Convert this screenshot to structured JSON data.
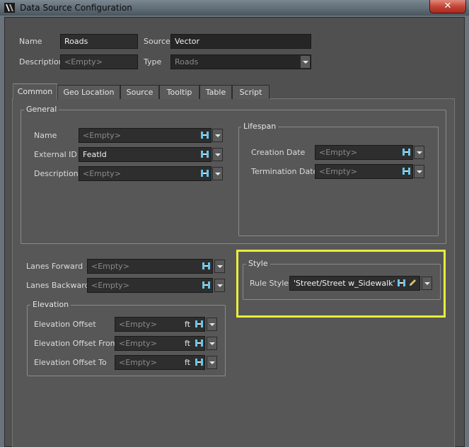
{
  "window": {
    "title": "Data Source Configuration",
    "close_glyph": "✕"
  },
  "header": {
    "name_label": "Name",
    "name_value": "Roads",
    "source_label": "Source",
    "source_value": "Vector",
    "description_label": "Description",
    "description_placeholder": "<Empty>",
    "type_label": "Type",
    "type_value": "Roads"
  },
  "tabs": [
    "Common",
    "Geo Location",
    "Source",
    "Tooltip",
    "Table",
    "Script"
  ],
  "active_tab": "Common",
  "general": {
    "title": "General",
    "name_label": "Name",
    "name_value": "<Empty>",
    "external_id_label": "External ID",
    "external_id_value": "FeatId",
    "description_label": "Description",
    "description_value": "<Empty>"
  },
  "lifespan": {
    "title": "Lifespan",
    "creation_label": "Creation Date",
    "creation_value": "<Empty>",
    "termination_label": "Termination Date",
    "termination_value": "<Empty>"
  },
  "lanes": {
    "forward_label": "Lanes Forward",
    "forward_value": "<Empty>",
    "backward_label": "Lanes Backward",
    "backward_value": "<Empty>"
  },
  "elevation": {
    "title": "Elevation",
    "offset_label": "Elevation Offset",
    "offset_value": "<Empty>",
    "offset_from_label": "Elevation Offset From",
    "offset_from_value": "<Empty>",
    "offset_to_label": "Elevation Offset To",
    "offset_to_value": "<Empty>",
    "unit": "ft"
  },
  "style": {
    "title": "Style",
    "rule_style_label": "Rule Style",
    "rule_style_value": "'Street/Street w_Sidewalk'"
  },
  "icons": {
    "bind": "bind-variable-icon",
    "edit": "pencil-icon",
    "dropdown": "chevron-down-icon"
  },
  "colors": {
    "highlight": "#e8ee3c",
    "bind_icon": "#66c7ee"
  }
}
